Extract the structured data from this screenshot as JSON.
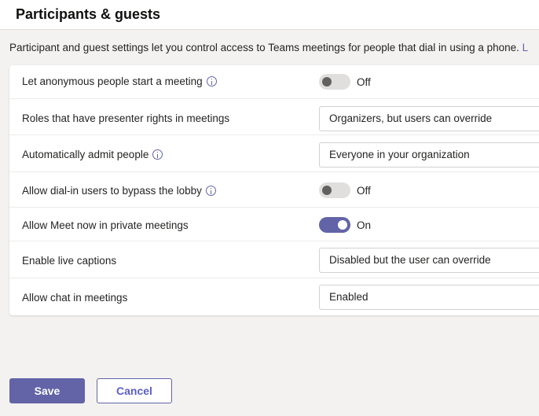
{
  "page": {
    "title": "Participants & guests",
    "description": "Participant and guest settings let you control access to Teams meetings for people that dial in using a phone.",
    "description_link": "L"
  },
  "settings": [
    {
      "label": "Let anonymous people start a meeting",
      "info": true,
      "control": "toggle",
      "state": "off",
      "value": "Off"
    },
    {
      "label": "Roles that have presenter rights in meetings",
      "info": false,
      "control": "dropdown",
      "value": "Organizers, but users can override"
    },
    {
      "label": "Automatically admit people",
      "info": true,
      "control": "dropdown",
      "value": "Everyone in your organization"
    },
    {
      "label": "Allow dial-in users to bypass the lobby",
      "info": true,
      "control": "toggle",
      "state": "off",
      "value": "Off"
    },
    {
      "label": "Allow Meet now in private meetings",
      "info": false,
      "control": "toggle",
      "state": "on",
      "value": "On"
    },
    {
      "label": "Enable live captions",
      "info": false,
      "control": "dropdown",
      "value": "Disabled but the user can override"
    },
    {
      "label": "Allow chat in meetings",
      "info": false,
      "control": "dropdown",
      "value": "Enabled"
    }
  ],
  "buttons": {
    "save": "Save",
    "cancel": "Cancel"
  },
  "colors": {
    "accent": "#6264a7",
    "background": "#f3f2f1",
    "card": "#ffffff",
    "toggle_off": "#e1dfdd"
  },
  "icons": {
    "info": "info-icon"
  }
}
